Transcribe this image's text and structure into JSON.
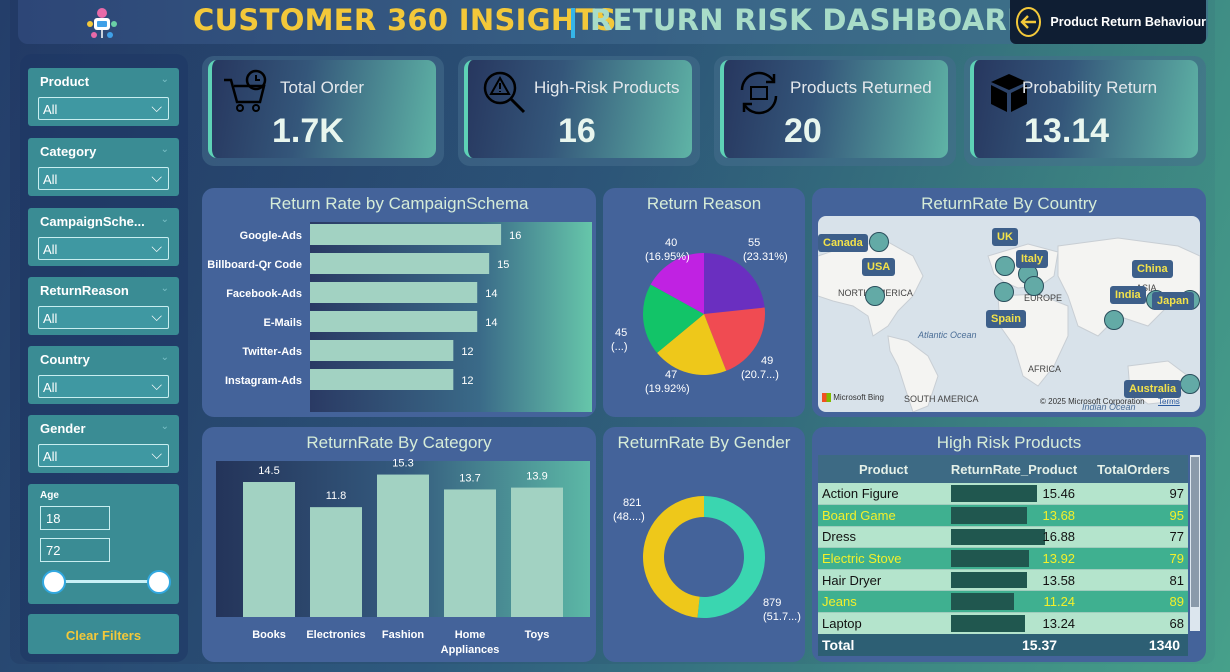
{
  "header": {
    "title_left": "CUSTOMER 360 INSIGHTS",
    "title_right": "RETURN RISK DASHBOARD",
    "nav_label": "Product Return Behaviour",
    "colors": {
      "accent_yellow": "#f3c83a",
      "accent_teal": "#a8dcc8",
      "separator": "#35b4e8"
    }
  },
  "filters": {
    "slicers": [
      {
        "label": "Product",
        "value": "All"
      },
      {
        "label": "Category",
        "value": "All"
      },
      {
        "label": "CampaignSche...",
        "value": "All"
      },
      {
        "label": "ReturnReason",
        "value": "All"
      },
      {
        "label": "Country",
        "value": "All"
      },
      {
        "label": "Gender",
        "value": "All"
      }
    ],
    "age": {
      "label": "Age",
      "min": "18",
      "max": "72"
    },
    "clear_label": "Clear Filters"
  },
  "kpis": [
    {
      "title": "Total Order",
      "value": "1.7K",
      "icon": "cart-clock-icon"
    },
    {
      "title": "High-Risk Products",
      "value": "16",
      "icon": "warning-search-icon"
    },
    {
      "title": "Products Returned",
      "value": "20",
      "icon": "return-cycle-icon"
    },
    {
      "title": "Probability Return",
      "value": "13.14",
      "icon": "box-icon"
    }
  ],
  "panels": {
    "campaign": "Return Rate by CampaignSchema",
    "reason": "Return Reason",
    "country": "ReturnRate By Country",
    "category": "ReturnRate By Category",
    "gender": "ReturnRate By Gender",
    "highrisk": "High Risk Products"
  },
  "chart_data": [
    {
      "type": "bar",
      "orientation": "horizontal",
      "title": "Return Rate by CampaignSchema",
      "categories": [
        "Google-Ads",
        "Billboard-Qr Code",
        "Facebook-Ads",
        "E-Mails",
        "Twitter-Ads",
        "Instagram-Ads"
      ],
      "values": [
        16,
        15,
        14,
        14,
        12,
        12
      ]
    },
    {
      "type": "pie",
      "title": "Return Reason",
      "values": [
        55,
        49,
        47,
        45,
        40
      ],
      "labels": [
        "55",
        "49",
        "47",
        "45",
        "40"
      ],
      "percent_labels": [
        "(23.31%)",
        "(20.7...)",
        "(19.92%)",
        "(...)",
        "(16.95%)"
      ],
      "colors": [
        "#6a2fc0",
        "#f04b52",
        "#eec81a",
        "#12c468",
        "#c022e2"
      ]
    },
    {
      "type": "bar",
      "title": "ReturnRate By Category",
      "categories": [
        "Books",
        "Electronics",
        "Fashion",
        "Home Appliances",
        "Toys"
      ],
      "values": [
        14.5,
        11.8,
        15.3,
        13.7,
        13.9
      ]
    },
    {
      "type": "pie",
      "subtype": "donut",
      "title": "ReturnRate By Gender",
      "values": [
        879,
        821
      ],
      "labels": [
        "879",
        "821"
      ],
      "percent_labels": [
        "(51.7...)",
        "(48....)"
      ],
      "colors": [
        "#3ad6b0",
        "#eec81a"
      ]
    },
    {
      "type": "table",
      "title": "High Risk Products",
      "columns": [
        "Product",
        "ReturnRate_Product",
        "TotalOrders"
      ],
      "rows": [
        [
          "Action Figure",
          15.46,
          97
        ],
        [
          "Board Game",
          13.68,
          95
        ],
        [
          "Dress",
          16.88,
          77
        ],
        [
          "Electric Stove",
          13.92,
          79
        ],
        [
          "Hair Dryer",
          13.58,
          81
        ],
        [
          "Jeans",
          11.24,
          89
        ],
        [
          "Laptop",
          13.24,
          68
        ]
      ],
      "total": [
        "Total",
        "15.37",
        "1340"
      ]
    }
  ],
  "map": {
    "countries": [
      "Canada",
      "USA",
      "UK",
      "Italy",
      "Spain",
      "China",
      "India",
      "Japan",
      "Australia"
    ],
    "geo_labels": [
      "NORTH AMERICA",
      "EUROPE",
      "AFRICA",
      "ASIA",
      "SOUTH AMERICA"
    ],
    "oceans": [
      "Atlantic Ocean",
      "Indian Ocean"
    ],
    "attribution": "Microsoft Bing",
    "copyright": "© 2025 Microsoft Corporation",
    "terms": "Terms"
  }
}
